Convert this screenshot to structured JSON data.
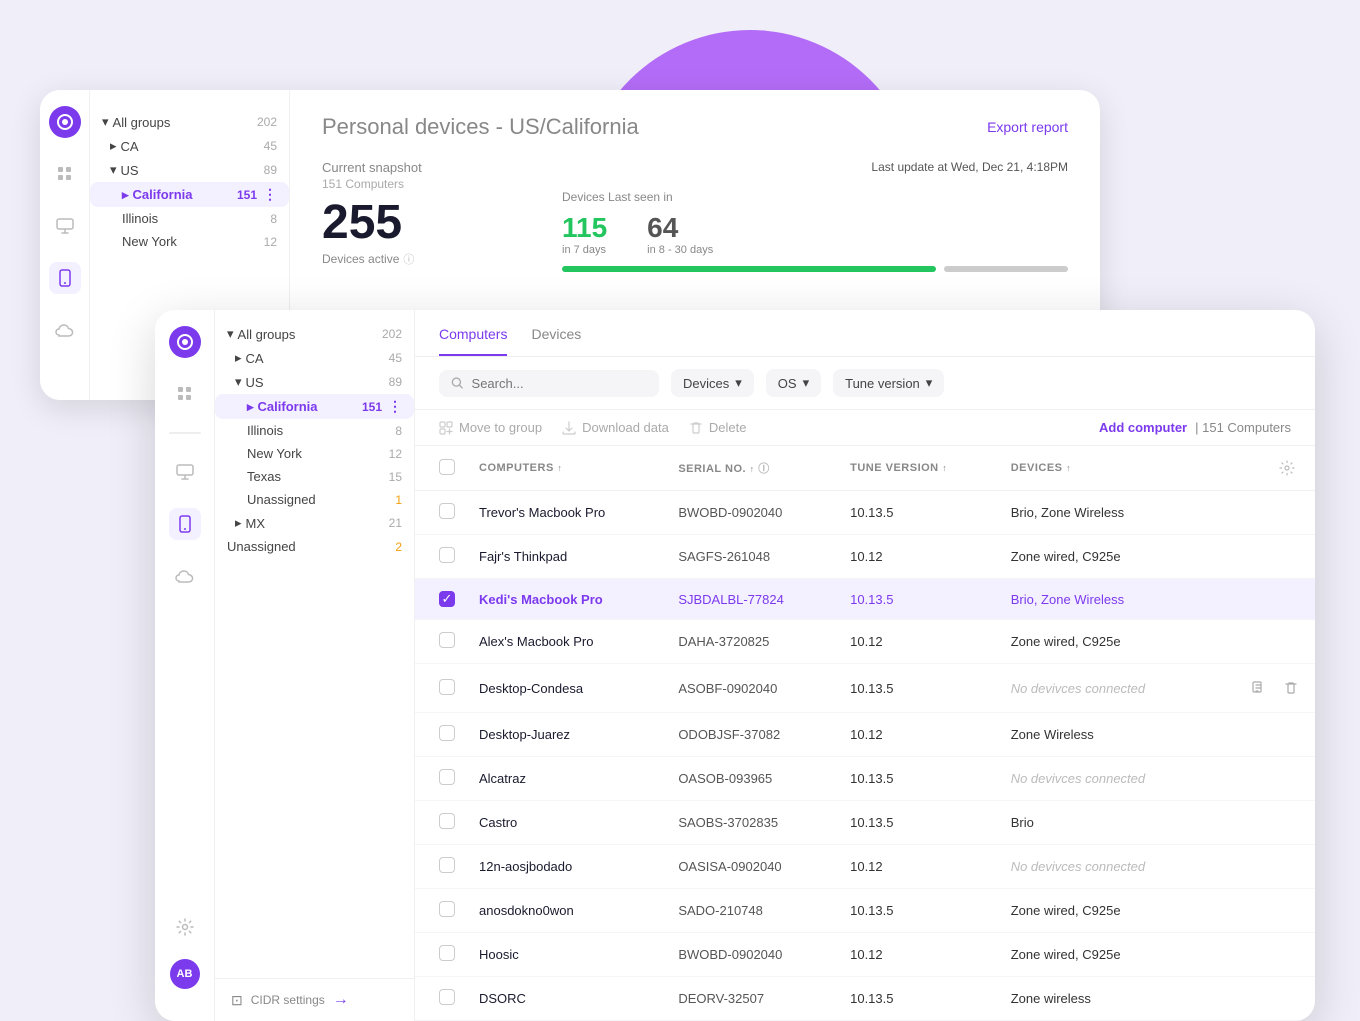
{
  "background_circle": {
    "color": "#a855f7"
  },
  "back_card": {
    "title": "Personal devices",
    "subtitle": "- US/California",
    "export_label": "Export report",
    "snapshot": {
      "label": "Current snapshot",
      "sublabel": "151 Computers",
      "number": "255",
      "active_label": "Devices active",
      "last_update_prefix": "Last update at",
      "last_update_value": "Wed, Dec 21, 4:18PM"
    },
    "devices_last_seen": {
      "label": "Devices Last seen in",
      "green_count": "115",
      "green_days": "in 7 days",
      "gray_count": "64",
      "gray_days": "in 8 - 30 days"
    },
    "sidebar": {
      "tree": [
        {
          "label": "All groups",
          "count": "202",
          "indent": 0,
          "expanded": true,
          "icon": "▾"
        },
        {
          "label": "CA",
          "count": "45",
          "indent": 1,
          "icon": "▸"
        },
        {
          "label": "US",
          "count": "89",
          "indent": 1,
          "expanded": true,
          "icon": "▾"
        },
        {
          "label": "California",
          "count": "151",
          "indent": 2,
          "selected": true,
          "icon": "▸"
        },
        {
          "label": "Illinois",
          "count": "8",
          "indent": 2
        },
        {
          "label": "New York",
          "count": "12",
          "indent": 2
        }
      ]
    }
  },
  "front_card": {
    "tabs": [
      {
        "label": "Computers",
        "active": true
      },
      {
        "label": "Devices",
        "active": false
      }
    ],
    "filters": {
      "search_placeholder": "Search...",
      "devices_label": "Devices",
      "os_label": "OS",
      "tune_version_label": "Tune version"
    },
    "actions": {
      "move_to_group": "Move to group",
      "download_data": "Download data",
      "delete": "Delete",
      "add_computer": "Add computer",
      "computers_count": "| 151 Computers"
    },
    "table": {
      "columns": [
        "COMPUTERS",
        "SERIAL NO.",
        "",
        "TUNE VERSION",
        "DEVICES",
        ""
      ],
      "rows": [
        {
          "name": "Trevor's Macbook Pro",
          "serial": "BWOBD-0902040",
          "tune": "10.13.5",
          "devices": "Brio, Zone Wireless",
          "selected": false,
          "no_devices": false
        },
        {
          "name": "Fajr's Thinkpad",
          "serial": "SAGFS-261048",
          "tune": "10.12",
          "devices": "Zone wired, C925e",
          "selected": false,
          "no_devices": false
        },
        {
          "name": "Kedi's Macbook Pro",
          "serial": "SJBDALBL-77824",
          "tune": "10.13.5",
          "devices": "Brio, Zone Wireless",
          "selected": true,
          "no_devices": false
        },
        {
          "name": "Alex's Macbook Pro",
          "serial": "DAHA-3720825",
          "tune": "10.12",
          "devices": "Zone wired, C925e",
          "selected": false,
          "no_devices": false
        },
        {
          "name": "Desktop-Condesa",
          "serial": "ASOBF-0902040",
          "tune": "10.13.5",
          "devices": "No devivces connected",
          "selected": false,
          "no_devices": true,
          "show_actions": true
        },
        {
          "name": "Desktop-Juarez",
          "serial": "ODOBJSF-37082",
          "tune": "10.12",
          "devices": "Zone Wireless",
          "selected": false,
          "no_devices": false
        },
        {
          "name": "Alcatraz",
          "serial": "OASOB-093965",
          "tune": "10.13.5",
          "devices": "No devivces connected",
          "selected": false,
          "no_devices": true
        },
        {
          "name": "Castro",
          "serial": "SAOBS-3702835",
          "tune": "10.13.5",
          "devices": "Brio",
          "selected": false,
          "no_devices": false
        },
        {
          "name": "12n-aosjbodado",
          "serial": "OASISA-0902040",
          "tune": "10.12",
          "devices": "No devivces connected",
          "selected": false,
          "no_devices": true
        },
        {
          "name": "anosdokno0won",
          "serial": "SADO-210748",
          "tune": "10.13.5",
          "devices": "Zone wired, C925e",
          "selected": false,
          "no_devices": false
        },
        {
          "name": "Hoosic",
          "serial": "BWOBD-0902040",
          "tune": "10.12",
          "devices": "Zone wired, C925e",
          "selected": false,
          "no_devices": false
        },
        {
          "name": "DSORC",
          "serial": "DEORV-32507",
          "tune": "10.13.5",
          "devices": "Zone wireless",
          "selected": false,
          "no_devices": false
        }
      ]
    },
    "sidebar": {
      "tree": [
        {
          "label": "All groups",
          "count": "202",
          "indent": 0,
          "expanded": true,
          "icon": "▾"
        },
        {
          "label": "CA",
          "count": "45",
          "indent": 1,
          "icon": "▸"
        },
        {
          "label": "US",
          "count": "89",
          "indent": 1,
          "expanded": true,
          "icon": "▾"
        },
        {
          "label": "California",
          "count": "151",
          "indent": 2,
          "selected": true,
          "icon": "▸"
        },
        {
          "label": "Illinois",
          "count": "8",
          "indent": 2
        },
        {
          "label": "New York",
          "count": "12",
          "indent": 2
        },
        {
          "label": "Texas",
          "count": "15",
          "indent": 2
        },
        {
          "label": "Unassigned",
          "count": "1",
          "indent": 2
        },
        {
          "label": "MX",
          "count": "21",
          "indent": 1,
          "icon": "▸"
        },
        {
          "label": "Unassigned",
          "count": "2",
          "indent": 0,
          "unassigned_top": true
        }
      ]
    },
    "cidr_label": "CIDR settings",
    "avatar_label": "AB"
  },
  "icons": {
    "purple_dot": "●",
    "grid": "⊞",
    "phone": "📱",
    "monitor": "🖥",
    "cloud": "☁",
    "gear": "⚙",
    "user": "👤",
    "search": "🔍",
    "chevron_down": "▾",
    "chevron_right": "▸",
    "sort_asc": "↑",
    "info": "ⓘ",
    "move": "⊡",
    "download": "⬇",
    "trash": "🗑",
    "edit": "✎",
    "cidr_icon": "⊡",
    "arrow_right": "→"
  }
}
